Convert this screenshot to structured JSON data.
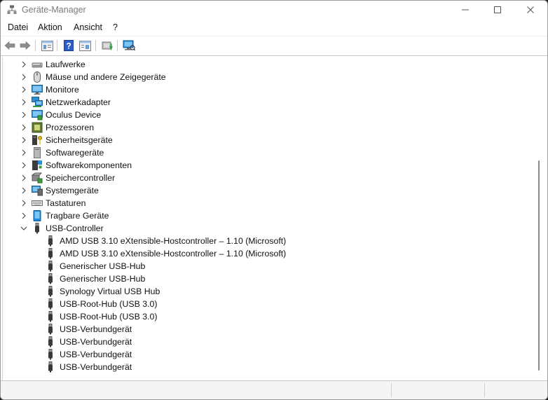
{
  "window": {
    "title": "Geräte-Manager",
    "controls": {
      "minimize_icon": "minimize-icon",
      "maximize_icon": "maximize-icon",
      "close_icon": "close-icon"
    }
  },
  "menu": {
    "items": [
      {
        "label": "Datei"
      },
      {
        "label": "Aktion"
      },
      {
        "label": "Ansicht"
      },
      {
        "label": "?"
      }
    ]
  },
  "toolbar": {
    "buttons": [
      "back-arrow-icon",
      "forward-arrow-icon",
      "properties-icon",
      "help-icon",
      "view-icon",
      "update-driver-icon",
      "scan-hardware-icon"
    ]
  },
  "tree": {
    "categories": [
      {
        "label": "Laufwerke",
        "icon": "disk-drive-icon",
        "expanded": false
      },
      {
        "label": "Mäuse und andere Zeigegeräte",
        "icon": "mouse-icon",
        "expanded": false
      },
      {
        "label": "Monitore",
        "icon": "monitor-icon",
        "expanded": false
      },
      {
        "label": "Netzwerkadapter",
        "icon": "network-adapter-icon",
        "expanded": false
      },
      {
        "label": "Oculus Device",
        "icon": "oculus-device-icon",
        "expanded": false
      },
      {
        "label": "Prozessoren",
        "icon": "processor-icon",
        "expanded": false
      },
      {
        "label": "Sicherheitsgeräte",
        "icon": "security-device-icon",
        "expanded": false
      },
      {
        "label": "Softwaregeräte",
        "icon": "software-device-icon",
        "expanded": false
      },
      {
        "label": "Softwarekomponenten",
        "icon": "software-component-icon",
        "expanded": false
      },
      {
        "label": "Speichercontroller",
        "icon": "storage-controller-icon",
        "expanded": false
      },
      {
        "label": "Systemgeräte",
        "icon": "system-device-icon",
        "expanded": false
      },
      {
        "label": "Tastaturen",
        "icon": "keyboard-icon",
        "expanded": false
      },
      {
        "label": "Tragbare Geräte",
        "icon": "portable-device-icon",
        "expanded": false
      },
      {
        "label": "USB-Controller",
        "icon": "usb-icon",
        "expanded": true
      }
    ],
    "usb_children": [
      {
        "label": "AMD USB 3.10 eXtensible-Hostcontroller – 1.10 (Microsoft)"
      },
      {
        "label": "AMD USB 3.10 eXtensible-Hostcontroller – 1.10 (Microsoft)"
      },
      {
        "label": "Generischer USB-Hub"
      },
      {
        "label": "Generischer USB-Hub"
      },
      {
        "label": "Synology Virtual USB Hub"
      },
      {
        "label": "USB-Root-Hub (USB 3.0)"
      },
      {
        "label": "USB-Root-Hub (USB 3.0)"
      },
      {
        "label": "USB-Verbundgerät"
      },
      {
        "label": "USB-Verbundgerät"
      },
      {
        "label": "USB-Verbundgerät"
      },
      {
        "label": "USB-Verbundgerät"
      }
    ]
  },
  "colors": {
    "accent": "#0078d4",
    "text": "#111111",
    "title_text": "#7a7a7a"
  }
}
